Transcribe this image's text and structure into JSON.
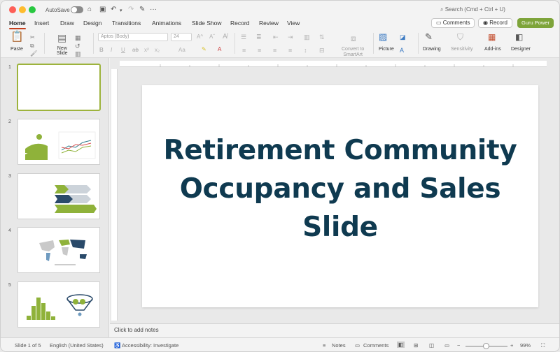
{
  "titlebar": {
    "autosave_label": "AutoSave",
    "search_text": "Search (Cmd + Ctrl + U)",
    "more": "···"
  },
  "tabs": [
    "Home",
    "Insert",
    "Draw",
    "Design",
    "Transitions",
    "Animations",
    "Slide Show",
    "Record",
    "Review",
    "View"
  ],
  "header_buttons": {
    "comments": "Comments",
    "record": "Record",
    "guru": "Guru Power"
  },
  "ribbon": {
    "paste": "Paste",
    "new_slide_1": "New",
    "new_slide_2": "Slide",
    "font_name": "Aptos (Body)",
    "font_size": "24",
    "convert_1": "Convert to",
    "convert_2": "SmartArt",
    "picture": "Picture",
    "drawing": "Drawing",
    "sensitivity": "Sensitivity",
    "addins": "Add-ins",
    "designer": "Designer",
    "font_row": [
      "B",
      "I",
      "U",
      "ab",
      "x²",
      "x₂",
      "Aa",
      "A"
    ]
  },
  "thumbnails": [
    {
      "num": "1"
    },
    {
      "num": "2"
    },
    {
      "num": "3"
    },
    {
      "num": "4"
    },
    {
      "num": "5"
    }
  ],
  "slide": {
    "title_line1": "Retirement Community",
    "title_line2": "Occupancy and Sales",
    "title_line3": "Slide"
  },
  "notes_placeholder": "Click to add notes",
  "status": {
    "slide_of": "Slide 1 of 5",
    "language": "English (United States)",
    "accessibility": "Accessibility: Investigate",
    "notes": "Notes",
    "comments": "Comments",
    "zoom": "99%"
  },
  "colors": {
    "title": "#0f3a50",
    "accent_green": "#7ea43a",
    "active_tab_underline": "#c43e1c"
  }
}
